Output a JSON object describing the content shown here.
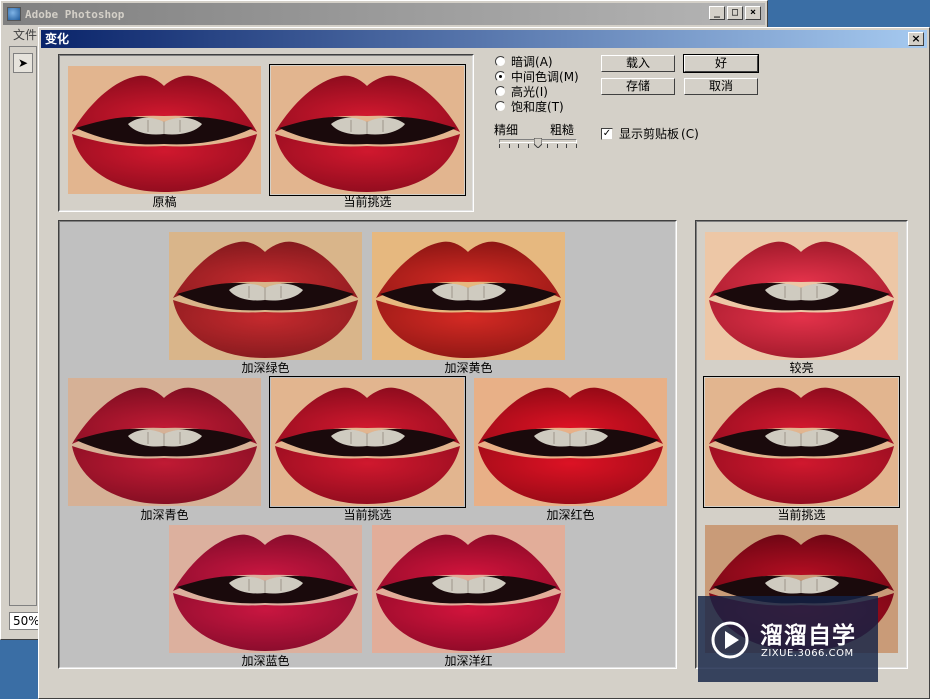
{
  "app": {
    "title": "Adobe Photoshop",
    "menu_first": "文件",
    "zoom": "50%",
    "window_controls": [
      "_",
      "□",
      "×"
    ]
  },
  "dialog": {
    "title": "变化",
    "close": "×"
  },
  "top_thumbs": {
    "original": "原稿",
    "current": "当前挑选"
  },
  "tone_options": [
    {
      "label": "暗调",
      "key": "(A)",
      "selected": false
    },
    {
      "label": "中间色调",
      "key": "(M)",
      "selected": true
    },
    {
      "label": "高光",
      "key": "(I)",
      "selected": false
    },
    {
      "label": "饱和度",
      "key": "(T)",
      "selected": false
    }
  ],
  "slider": {
    "fine_label": "精细",
    "coarse_label": "粗糙",
    "position": 0.5
  },
  "buttons": {
    "load": "载入",
    "ok": "好",
    "save": "存储",
    "cancel": "取消"
  },
  "clipping": {
    "label": "显示剪贴板",
    "key": "(C)",
    "checked": true
  },
  "color_grid": {
    "more_green": "加深绿色",
    "more_yellow": "加深黄色",
    "more_cyan": "加深青色",
    "current": "当前挑选",
    "more_red": "加深红色",
    "more_blue": "加深蓝色",
    "more_magenta": "加深洋红"
  },
  "lightness": {
    "lighter": "较亮",
    "current": "当前挑选"
  },
  "colors": {
    "lip_base": "#d0182e",
    "skin": "#e2b58f",
    "title_bar": "#0a246a"
  },
  "watermark": {
    "title": "溜溜自学",
    "subtitle": "ZIXUE.3066.COM"
  }
}
